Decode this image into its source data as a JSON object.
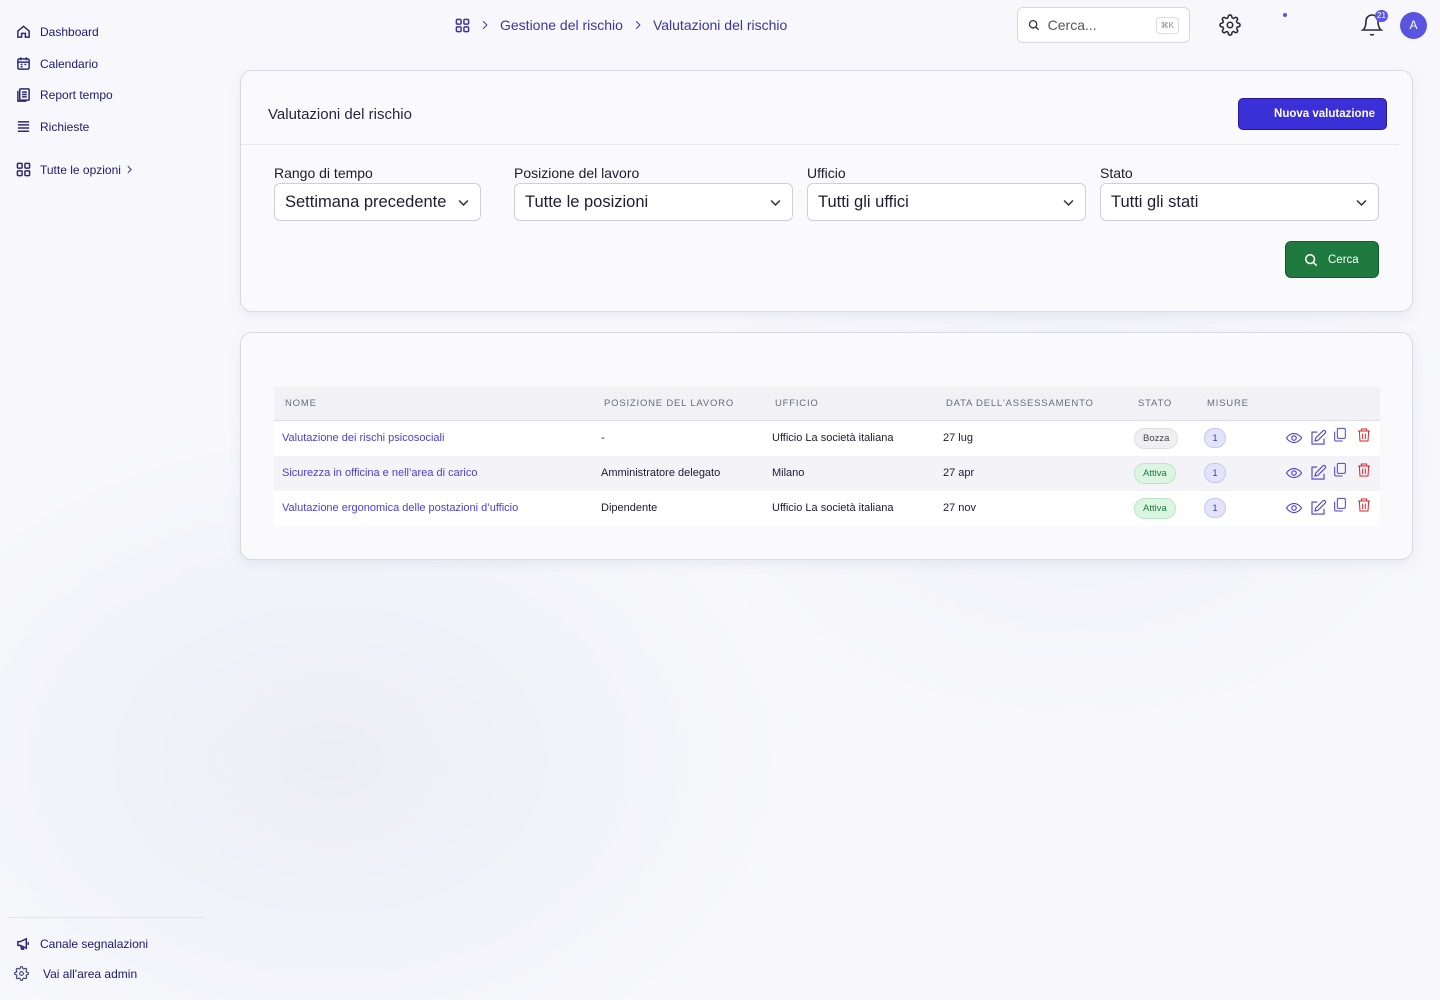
{
  "sidebar": {
    "items": [
      {
        "label": "Dashboard",
        "icon": "home-icon"
      },
      {
        "label": "Calendario",
        "icon": "calendar-icon"
      },
      {
        "label": "Report tempo",
        "icon": "report-icon"
      },
      {
        "label": "Richieste",
        "icon": "list-icon"
      }
    ],
    "all_options": "Tutte le opzioni",
    "footer": {
      "channel": "Canale segnalazioni",
      "admin": "Vai all'area admin"
    }
  },
  "header": {
    "breadcrumb": [
      "Gestione del rischio",
      "Valutazioni del rischio"
    ],
    "search_placeholder": "Cerca...",
    "search_shortcut": "⌘K",
    "notifications_count": "21",
    "avatar_initial": "A"
  },
  "filters": {
    "title": "Valutazioni del rischio",
    "new_button": "Nuova valutazione",
    "fields": [
      {
        "label": "Rango di tempo",
        "value": "Settimana precedente"
      },
      {
        "label": "Posizione del lavoro",
        "value": "Tutte le posizioni"
      },
      {
        "label": "Ufficio",
        "value": "Tutti gli uffici"
      },
      {
        "label": "Stato",
        "value": "Tutti gli stati"
      }
    ],
    "search_button": "Cerca"
  },
  "table": {
    "columns": [
      "NOME",
      "POSIZIONE DEL LAVORO",
      "UFFICIO",
      "DATA DELL'ASSESSAMENTO",
      "STATO",
      "MISURE"
    ],
    "rows": [
      {
        "name": "Valutazione dei rischi psicosociali",
        "position": "-",
        "office": "Ufficio La società italiana",
        "date": "27 lug",
        "status": "Bozza",
        "measures": "1"
      },
      {
        "name": "Sicurezza in officina e nell’area di carico",
        "position": "Amministratore delegato",
        "office": "Milano",
        "date": "27 apr",
        "status": "Attiva",
        "measures": "1"
      },
      {
        "name": "Valutazione ergonomica delle postazioni d’ufficio",
        "position": "Dipendente",
        "office": "Ufficio La società italiana",
        "date": "27 nov",
        "status": "Attiva",
        "measures": "1"
      }
    ]
  },
  "colors": {
    "primary": "#3b2fd8",
    "success": "#1e7a3f",
    "link": "#4b3fd1",
    "danger": "#d8262c"
  }
}
